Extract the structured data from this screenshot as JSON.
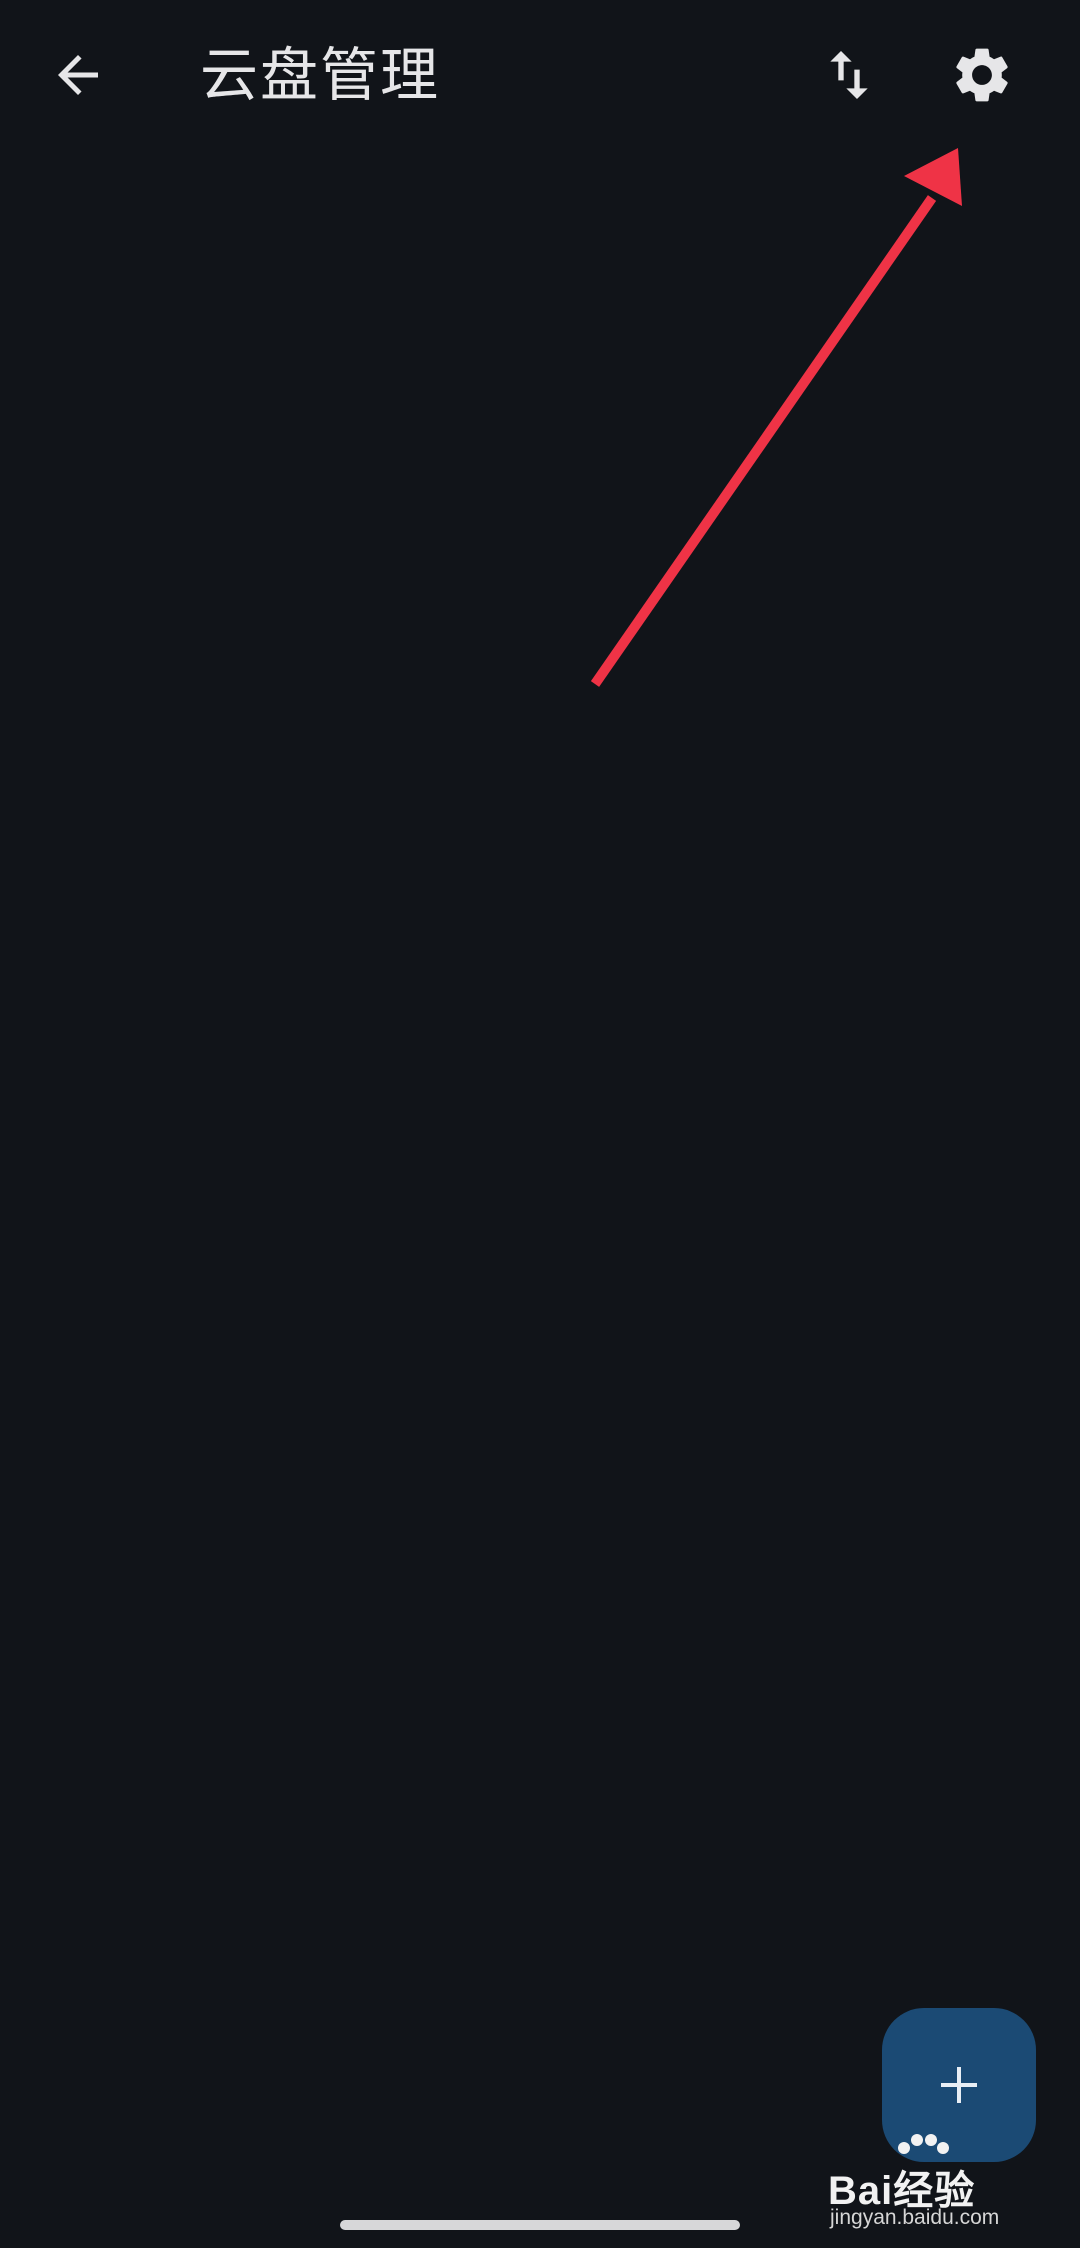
{
  "header": {
    "title": "云盘管理",
    "back_icon": "arrow-back-icon",
    "sort_icon": "swap-vertical-icon",
    "settings_icon": "gear-icon"
  },
  "fab": {
    "icon": "plus-icon"
  },
  "watermark": {
    "brand": "Bai经验",
    "url": "jingyan.baidu.com"
  },
  "colors": {
    "background": "#111419",
    "text": "#e6e6e8",
    "fab": "#1b4a74",
    "annotation": "#ef3346"
  }
}
